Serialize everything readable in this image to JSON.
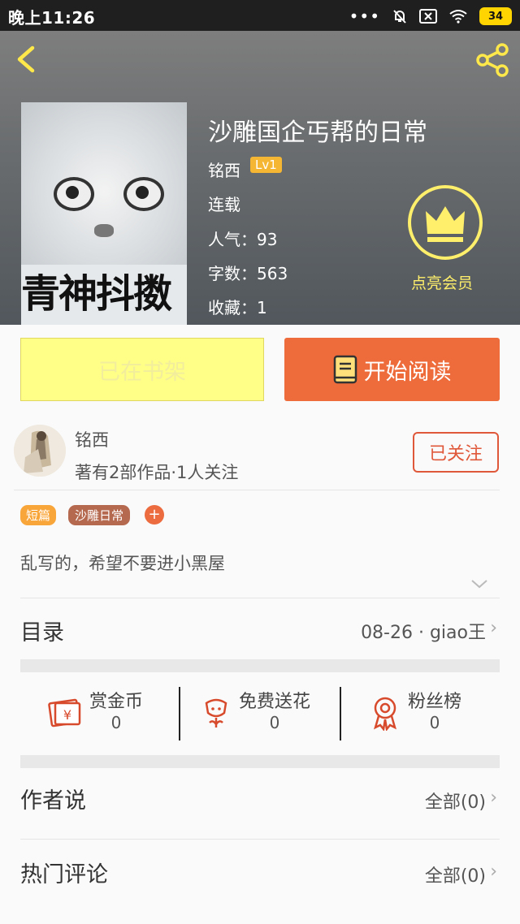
{
  "status_bar": {
    "time": "晚上11:26",
    "battery": "34"
  },
  "book": {
    "title": "沙雕国企丐帮的日常",
    "author": "铭西",
    "level": "Lv1",
    "status": "连载",
    "popularity": "人气：93",
    "words": "字数：563",
    "favorites": "收藏：1",
    "cover_text": "青神抖擞",
    "vip_label": "点亮会员"
  },
  "actions": {
    "shelf_label": "已在书架",
    "read_label": "开始阅读"
  },
  "author_card": {
    "name": "铭西",
    "meta": "著有2部作品·1人关注",
    "follow_label": "已关注"
  },
  "tags": [
    "短篇",
    "沙雕日常"
  ],
  "tag_add": "+",
  "description": "乱写的，希望不要进小黑屋",
  "toc": {
    "label": "目录",
    "latest": "08-26 · giao王"
  },
  "rewards": [
    {
      "label": "赏金币",
      "count": "0",
      "icon": "red-envelope-icon"
    },
    {
      "label": "免费送花",
      "count": "0",
      "icon": "flower-icon"
    },
    {
      "label": "粉丝榜",
      "count": "0",
      "icon": "medal-icon"
    }
  ],
  "author_says": {
    "label": "作者说",
    "all": "全部(0)"
  },
  "hot_comments": {
    "label": "热门评论",
    "all": "全部(0)"
  },
  "colors": {
    "accent": "#ee6b3b",
    "shelf_bg": "#ffff88",
    "vip": "#ffef6a"
  }
}
